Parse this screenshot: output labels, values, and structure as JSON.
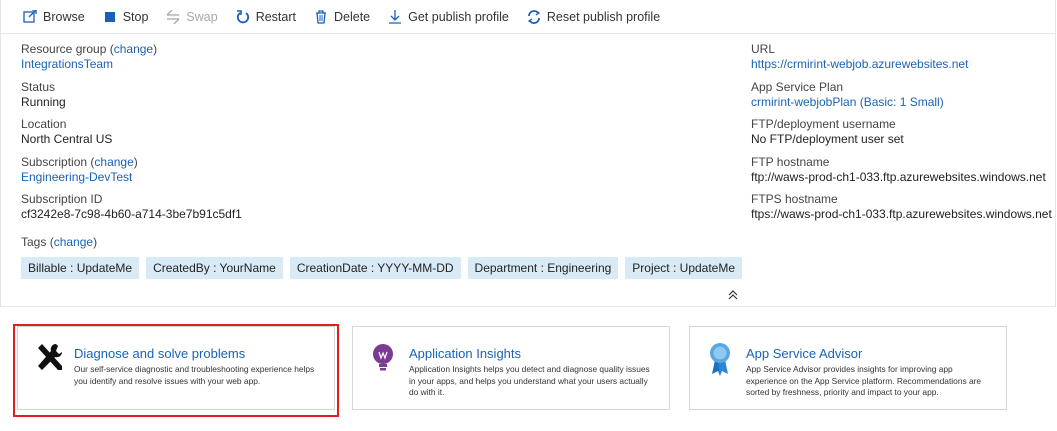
{
  "toolbar": {
    "browse": "Browse",
    "stop": "Stop",
    "swap": "Swap",
    "restart": "Restart",
    "delete": "Delete",
    "get_publish_profile": "Get publish profile",
    "reset_publish_profile": "Reset publish profile"
  },
  "essentials": {
    "resource_group": {
      "label": "Resource group",
      "change": "change",
      "value": "IntegrationsTeam"
    },
    "status": {
      "label": "Status",
      "value": "Running"
    },
    "location": {
      "label": "Location",
      "value": "North Central US"
    },
    "subscription": {
      "label": "Subscription",
      "change": "change",
      "value": "Engineering-DevTest"
    },
    "subscription_id": {
      "label": "Subscription ID",
      "value": "cf3242e8-7c98-4b60-a714-3be7b91c5df1"
    },
    "url": {
      "label": "URL",
      "value": "https://crmirint-webjob.azurewebsites.net"
    },
    "app_service_plan": {
      "label": "App Service Plan",
      "value": "crmirint-webjobPlan (Basic: 1 Small)"
    },
    "ftp_username": {
      "label": "FTP/deployment username",
      "value": "No FTP/deployment user set"
    },
    "ftp_hostname": {
      "label": "FTP hostname",
      "value": "ftp://waws-prod-ch1-033.ftp.azurewebsites.windows.net"
    },
    "ftps_hostname": {
      "label": "FTPS hostname",
      "value": "ftps://waws-prod-ch1-033.ftp.azurewebsites.windows.net"
    }
  },
  "tags": {
    "label": "Tags",
    "change": "change",
    "items": [
      "Billable : UpdateMe",
      "CreatedBy : YourName",
      "CreationDate : YYYY-MM-DD",
      "Department : Engineering",
      "Project : UpdateMe"
    ]
  },
  "tiles": [
    {
      "title": "Diagnose and solve problems",
      "description": "Our self-service diagnostic and troubleshooting experience helps you identify and resolve issues with your web app."
    },
    {
      "title": "Application Insights",
      "description": "Application Insights helps you detect and diagnose quality issues in your apps, and helps you understand what your users actually do with it."
    },
    {
      "title": "App Service Advisor",
      "description": "App Service Advisor provides insights for improving app experience on the App Service platform. Recommendations are sorted by freshness, priority and impact to your app."
    }
  ],
  "colors": {
    "link": "#1a62b5",
    "tag_bg": "#d9eaf7",
    "highlight": "#e31b23",
    "command_icon": "#1b5fb8"
  }
}
